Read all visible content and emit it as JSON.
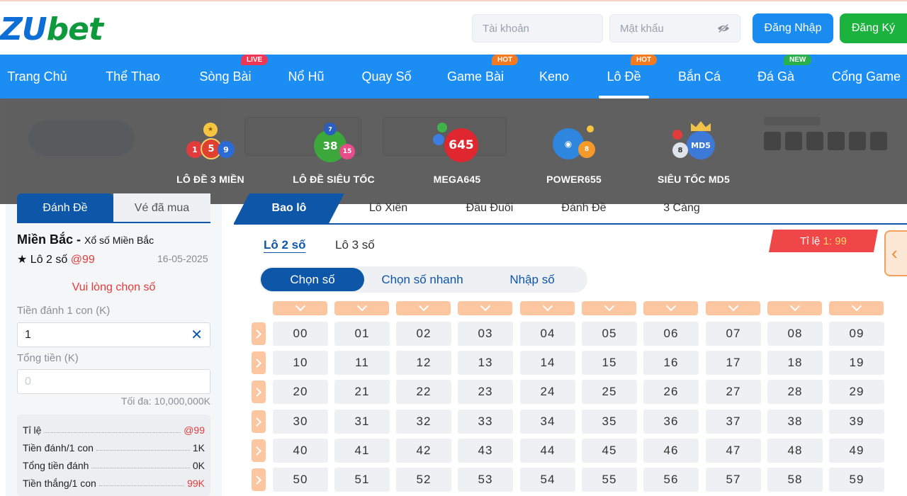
{
  "brand": {
    "logo_main": "ZU",
    "logo_accent": "bet"
  },
  "auth": {
    "username_placeholder": "Tài khoản",
    "password_placeholder": "Mật khẩu",
    "login_label": "Đăng Nhập",
    "register_label": "Đăng Ký"
  },
  "nav": [
    {
      "label": "Trang Chủ"
    },
    {
      "label": "Thể Thao"
    },
    {
      "label": "Sòng Bài",
      "badge": "LIVE"
    },
    {
      "label": "Nổ Hũ"
    },
    {
      "label": "Quay Số"
    },
    {
      "label": "Game Bài",
      "badge": "HOT"
    },
    {
      "label": "Keno"
    },
    {
      "label": "Lô Đề",
      "badge": "HOT",
      "active": true
    },
    {
      "label": "Bắn Cá"
    },
    {
      "label": "Đá Gà",
      "badge": "NEW"
    },
    {
      "label": "Cổng Game"
    }
  ],
  "games_menu": [
    {
      "label": "LÔ ĐỀ 3 MIỀN",
      "icon": "lottery-3-mien-icon"
    },
    {
      "label": "LÔ ĐỀ SIÊU TỐC",
      "icon": "lottery-sieu-toc-icon"
    },
    {
      "label": "MEGA645",
      "icon": "mega645-icon"
    },
    {
      "label": "POWER655",
      "icon": "power655-icon"
    },
    {
      "label": "SIÊU TỐC MD5",
      "icon": "sieu-toc-md5-icon"
    }
  ],
  "left": {
    "tab_bet": "Đánh Đề",
    "tab_tickets": "Vé đã mua",
    "region": "Miền Bắc -",
    "region_sub": "Xổ số Miền Bắc",
    "bet_type": "★ Lô 2 số",
    "bet_rate": "@99",
    "date": "16-05-2025",
    "warning": "Vui lòng chọn số",
    "stake_label": "Tiền đánh 1 con (K)",
    "stake_value": "1",
    "total_label": "Tổng tiền (K)",
    "total_placeholder": "0",
    "max_note": "Tối đa: 10,000,000K",
    "summary": [
      {
        "label": "Tỉ lệ",
        "value": "@99",
        "red": true
      },
      {
        "label": "Tiền đánh/1 con",
        "value": "1K",
        "red": false
      },
      {
        "label": "Tổng tiền đánh",
        "value": "0K",
        "red": false
      },
      {
        "label": "Tiền thắng/1 con",
        "value": "99K",
        "red": true
      }
    ]
  },
  "main_tabs": [
    "Bao lô",
    "Lô Xiên",
    "Đầu Đuôi",
    "Đánh Đề",
    "3 Càng"
  ],
  "sub_tabs": [
    "Lô 2 số",
    "Lô 3 số"
  ],
  "rate": {
    "label": "Tỉ lệ",
    "value": "1: 99"
  },
  "pick_tabs": [
    "Chọn số",
    "Chọn số nhanh",
    "Nhập số"
  ],
  "numbers": [
    [
      "00",
      "01",
      "02",
      "03",
      "04",
      "05",
      "06",
      "07",
      "08",
      "09"
    ],
    [
      "10",
      "11",
      "12",
      "13",
      "14",
      "15",
      "16",
      "17",
      "18",
      "19"
    ],
    [
      "20",
      "21",
      "22",
      "23",
      "24",
      "25",
      "26",
      "27",
      "28",
      "29"
    ],
    [
      "30",
      "31",
      "32",
      "33",
      "34",
      "35",
      "36",
      "37",
      "38",
      "39"
    ],
    [
      "40",
      "41",
      "42",
      "43",
      "44",
      "45",
      "46",
      "47",
      "48",
      "49"
    ],
    [
      "50",
      "51",
      "52",
      "53",
      "54",
      "55",
      "56",
      "57",
      "58",
      "59"
    ]
  ],
  "colors": {
    "primary": "#0d56a8",
    "nav": "#1c8ef3",
    "register": "#1bb23e",
    "accent_red": "#e13b3b",
    "chevron": "#fbc6a0"
  }
}
